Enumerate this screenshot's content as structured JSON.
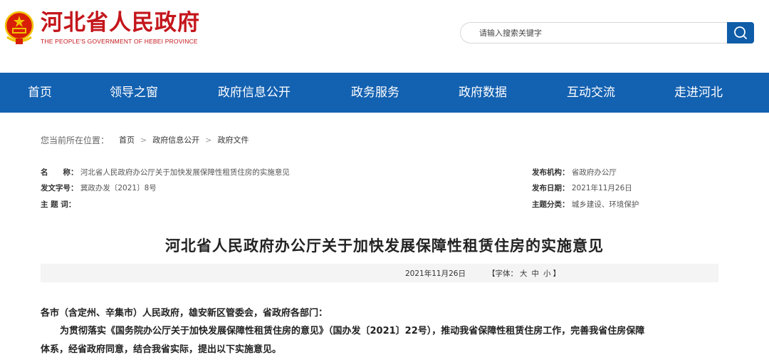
{
  "header": {
    "site_title": "河北省人民政府",
    "site_subtitle": "THE PEOPLE'S GOVERNMENT OF HEBEI PROVINCE",
    "search_placeholder": "请输入搜索关键字"
  },
  "nav": {
    "items": [
      "首页",
      "领导之窗",
      "政府信息公开",
      "政务服务",
      "政府数据",
      "互动交流",
      "走进河北"
    ]
  },
  "breadcrumb": {
    "prefix": "您当前所在位置：",
    "items": [
      "首页",
      "政府信息公开",
      "政府文件"
    ]
  },
  "meta": {
    "name_label": "名　　称：",
    "name_value": "河北省人民政府办公厅关于加快发展保障性租赁住房的实施意见",
    "doc_no_label": "发文字号：",
    "doc_no_value": "冀政办发〔2021〕8号",
    "subject_label": "主 题 词：",
    "subject_value": "",
    "issuer_label": "发布机构：",
    "issuer_value": "省政府办公厅",
    "date_label": "发布日期：",
    "date_value": "2021年11月26日",
    "category_label": "主题分类：",
    "category_value": "城乡建设、环境保护"
  },
  "article": {
    "title": "河北省人民政府办公厅关于加快发展保障性租赁住房的实施意见",
    "date": "2021年11月26日",
    "font_label_open": "【字体：",
    "font_large": "大",
    "font_medium": "中",
    "font_small": "小",
    "font_label_close": "】",
    "salutation": "各市（含定州、辛集市）人民政府，雄安新区管委会，省政府各部门：",
    "para1_line1": "为贯彻落实《国务院办公厅关于加快发展保障性租赁住房的意见》（国办发〔2021〕22号），推动我省保障性租赁住房工作，完善我省住房保障",
    "para1_line2": "体系，经省政府同意，结合我省实际，提出以下实施意见。"
  },
  "colors": {
    "brand_red": "#c4161c",
    "nav_blue": "#1361b1",
    "search_button": "#0f5ca8"
  }
}
